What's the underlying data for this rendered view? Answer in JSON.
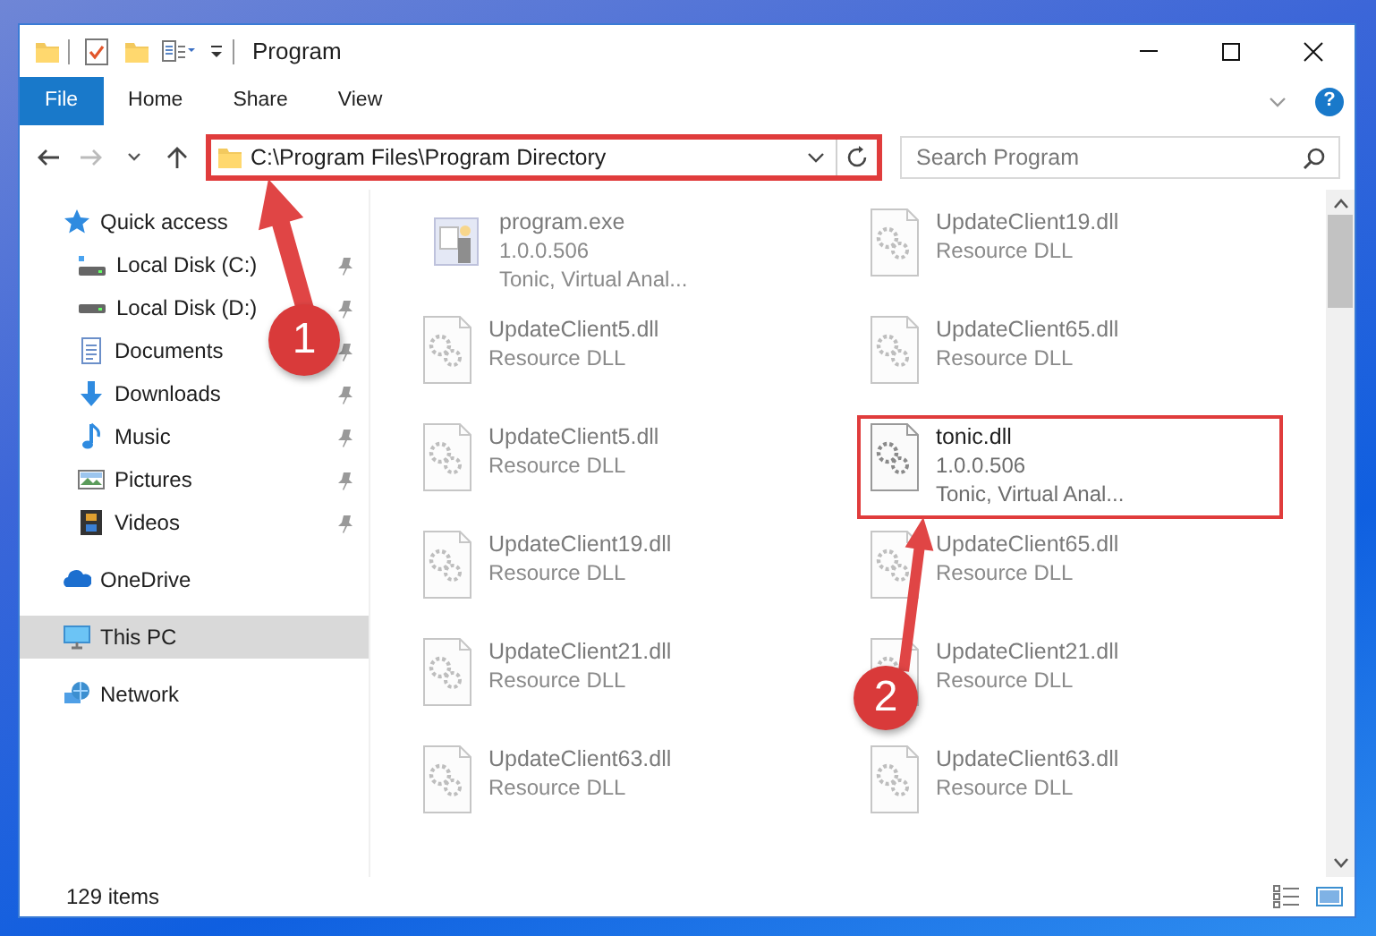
{
  "window": {
    "title": "Program"
  },
  "ribbon": {
    "tabs": [
      {
        "label": "File",
        "selected": true
      },
      {
        "label": "Home",
        "selected": false
      },
      {
        "label": "Share",
        "selected": false
      },
      {
        "label": "View",
        "selected": false
      }
    ],
    "help": "?"
  },
  "address": {
    "path": "C:\\Program Files\\Program Directory",
    "highlighted": true
  },
  "search": {
    "placeholder": "Search Program"
  },
  "sidebar": {
    "items": [
      {
        "label": "Quick access",
        "pinned": false,
        "selected": false
      },
      {
        "label": "Local Disk (C:)",
        "pinned": true,
        "selected": false
      },
      {
        "label": "Local Disk (D:)",
        "pinned": true,
        "selected": false
      },
      {
        "label": "Documents",
        "pinned": true,
        "selected": false
      },
      {
        "label": "Downloads",
        "pinned": true,
        "selected": false
      },
      {
        "label": "Music",
        "pinned": true,
        "selected": false
      },
      {
        "label": "Pictures",
        "pinned": true,
        "selected": false
      },
      {
        "label": "Videos",
        "pinned": true,
        "selected": false
      },
      {
        "label": "OneDrive",
        "pinned": false,
        "selected": false
      },
      {
        "label": "This PC",
        "pinned": false,
        "selected": true
      },
      {
        "label": "Network",
        "pinned": false,
        "selected": false
      }
    ]
  },
  "files": [
    {
      "kind": "exe",
      "name": "program.exe",
      "lines": [
        "1.0.0.506",
        "Tonic, Virtual Anal..."
      ],
      "blurred": true,
      "highlighted": false
    },
    {
      "kind": "dll",
      "name": "UpdateClient19.dll",
      "lines": [
        "Resource DLL"
      ],
      "blurred": true,
      "highlighted": false
    },
    {
      "kind": "dll",
      "name": "UpdateClient5.dll",
      "lines": [
        "Resource DLL"
      ],
      "blurred": true,
      "highlighted": false
    },
    {
      "kind": "dll",
      "name": "UpdateClient65.dll",
      "lines": [
        "Resource DLL"
      ],
      "blurred": true,
      "highlighted": false
    },
    {
      "kind": "dll",
      "name": "UpdateClient5.dll",
      "lines": [
        "Resource DLL"
      ],
      "blurred": true,
      "highlighted": false
    },
    {
      "kind": "dll",
      "name": "tonic.dll",
      "lines": [
        "1.0.0.506",
        "Tonic, Virtual Anal..."
      ],
      "blurred": false,
      "highlighted": true
    },
    {
      "kind": "dll",
      "name": "UpdateClient19.dll",
      "lines": [
        "Resource DLL"
      ],
      "blurred": true,
      "highlighted": false
    },
    {
      "kind": "dll",
      "name": "UpdateClient65.dll",
      "lines": [
        "Resource DLL"
      ],
      "blurred": true,
      "highlighted": false
    },
    {
      "kind": "dll",
      "name": "UpdateClient21.dll",
      "lines": [
        "Resource DLL"
      ],
      "blurred": true,
      "highlighted": false
    },
    {
      "kind": "dll",
      "name": "UpdateClient21.dll",
      "lines": [
        "Resource DLL"
      ],
      "blurred": true,
      "highlighted": false
    },
    {
      "kind": "dll",
      "name": "UpdateClient63.dll",
      "lines": [
        "Resource DLL"
      ],
      "blurred": true,
      "highlighted": false
    },
    {
      "kind": "dll",
      "name": "UpdateClient63.dll",
      "lines": [
        "Resource DLL"
      ],
      "blurred": true,
      "highlighted": false
    }
  ],
  "status_bar": {
    "count": "129 items"
  },
  "annotations": [
    {
      "label": "1"
    },
    {
      "label": "2"
    }
  ]
}
